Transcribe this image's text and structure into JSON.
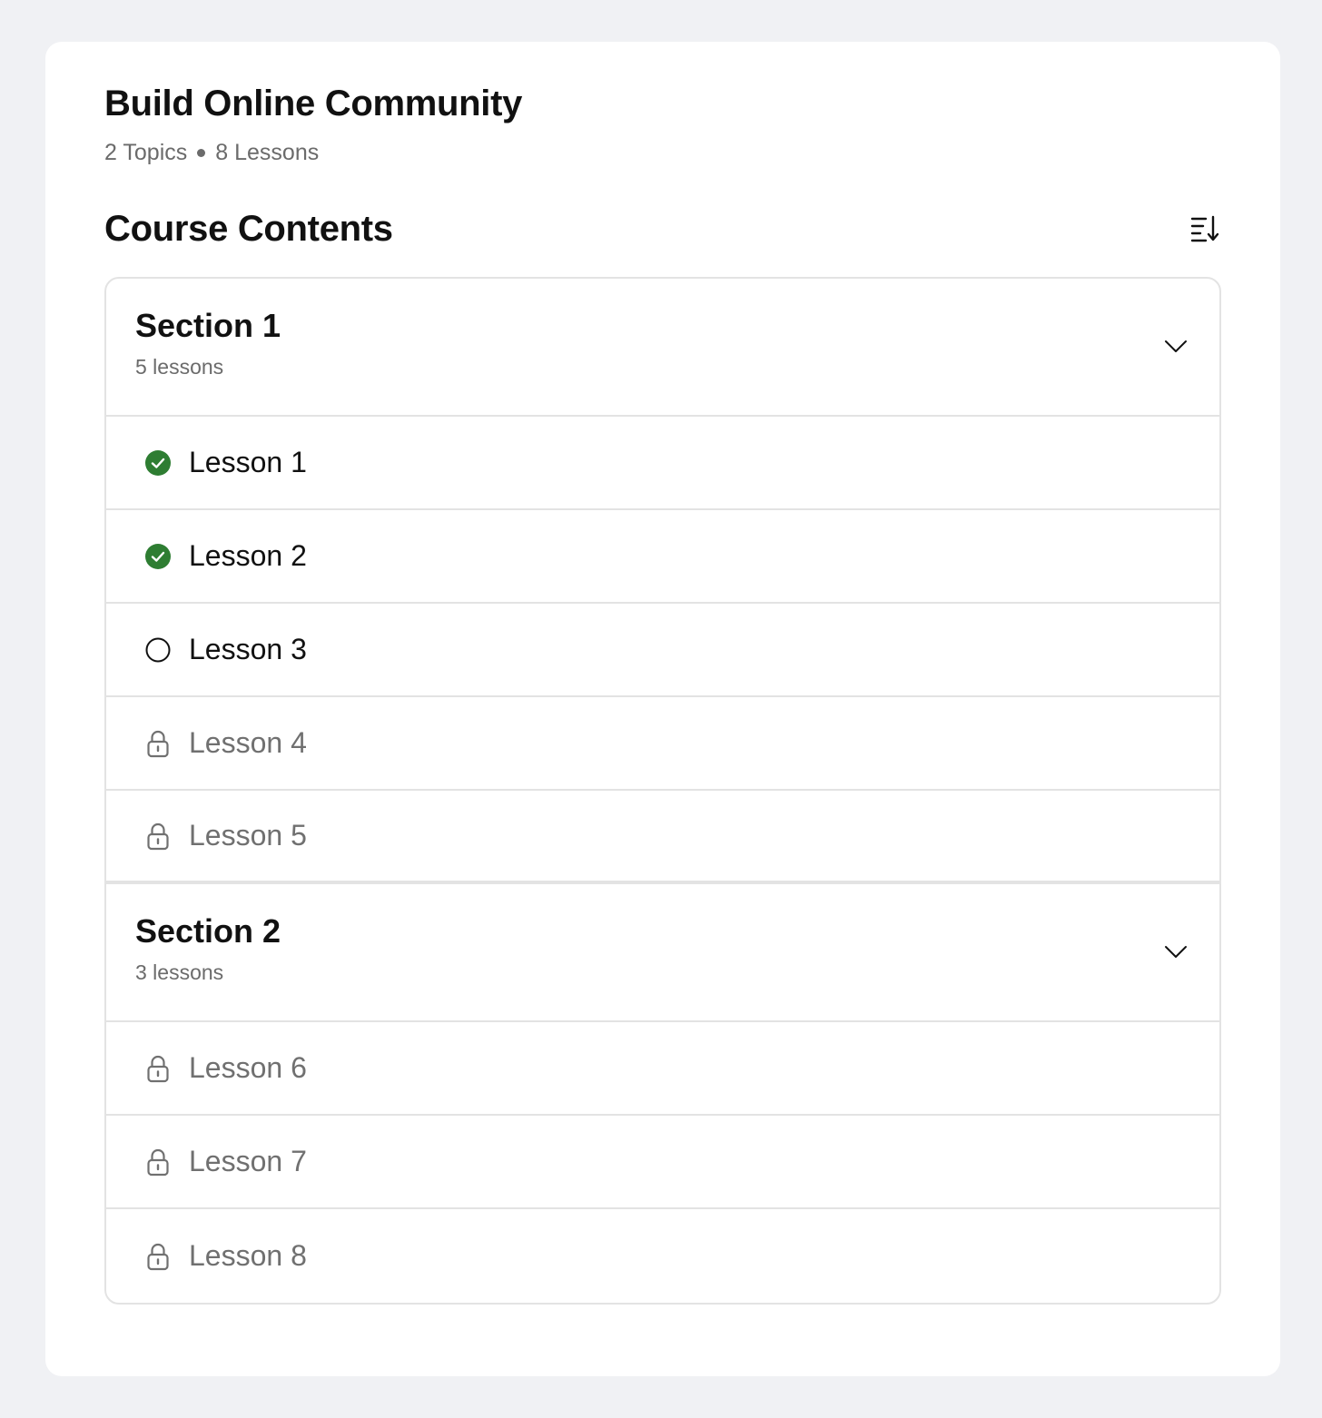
{
  "course": {
    "title": "Build Online Community",
    "topics": "2 Topics",
    "lessons": "8 Lessons"
  },
  "contents": {
    "title": "Course Contents",
    "sort_icon": "sort-descending-icon"
  },
  "colors": {
    "complete": "#2e7d32",
    "locked": "#707070",
    "border": "#e3e3e3"
  },
  "sections": [
    {
      "title": "Section 1",
      "count": "5 lessons",
      "lessons": [
        {
          "label": "Lesson 1",
          "status": "complete"
        },
        {
          "label": "Lesson 2",
          "status": "complete"
        },
        {
          "label": "Lesson 3",
          "status": "incomplete"
        },
        {
          "label": "Lesson 4",
          "status": "locked"
        },
        {
          "label": "Lesson 5",
          "status": "locked"
        }
      ]
    },
    {
      "title": "Section 2",
      "count": "3 lessons",
      "lessons": [
        {
          "label": "Lesson 6",
          "status": "locked"
        },
        {
          "label": "Lesson 7",
          "status": "locked"
        },
        {
          "label": "Lesson 8",
          "status": "locked"
        }
      ]
    }
  ]
}
